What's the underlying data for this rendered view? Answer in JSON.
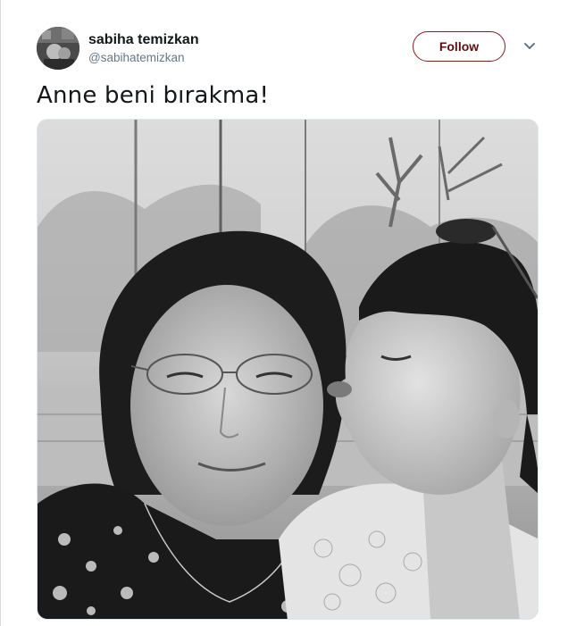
{
  "tweet": {
    "display_name": "sabiha temizkan",
    "handle": "@sabihatemizkan",
    "follow_label": "Follow",
    "text": "Anne beni bırakma!",
    "avatar_icon": "user-avatar",
    "menu_icon": "chevron-down-icon",
    "media_description_icon": "photo"
  },
  "colors": {
    "name_text": "#14171a",
    "handle_text": "#657786",
    "follow_border": "#7b1f1f",
    "follow_text": "#5c0f0f"
  }
}
